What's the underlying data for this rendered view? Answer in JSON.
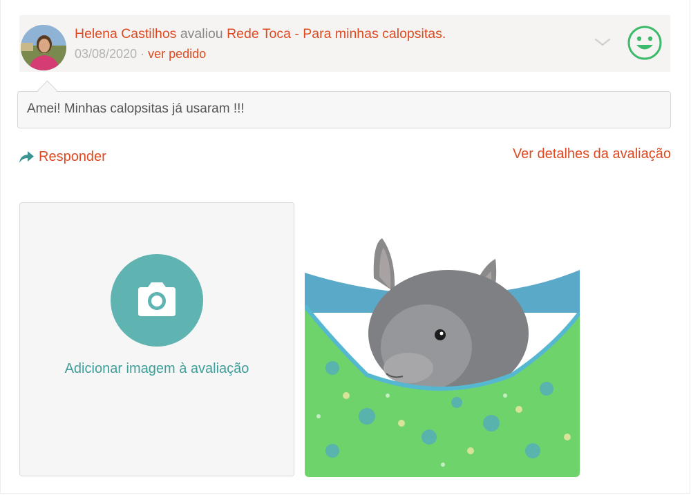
{
  "review": {
    "reviewer_name": "Helena Castilhos",
    "action_word": " avaliou ",
    "product_name": "Rede Toca - Para minhas calopsitas.",
    "date": "03/08/2020",
    "separator": " · ",
    "order_link": "ver pedido",
    "sentiment": "happy-smiley-icon",
    "comment": "Amei! Minhas calopsitas já usaram !!!"
  },
  "actions": {
    "reply_label": "Responder",
    "details_label": "Ver detalhes da avaliação"
  },
  "upload": {
    "label": "Adicionar imagem à avaliação"
  },
  "colors": {
    "accent": "#e0491f",
    "teal": "#5fb3b0",
    "teal_text": "#3d9e9a",
    "smiley_green": "#3dba6c",
    "header_bg": "#f5f4f2"
  }
}
